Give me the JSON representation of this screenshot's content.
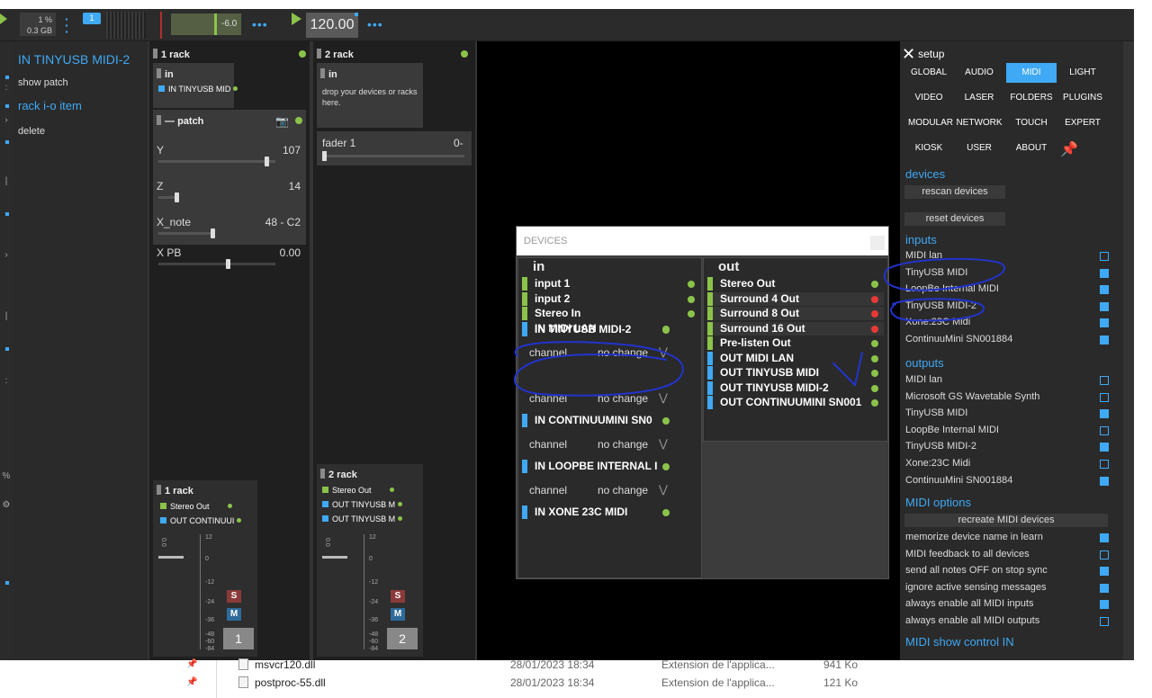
{
  "toolbar": {
    "cpu_percent": "1 %",
    "memory": "0.3 GB",
    "track_badge": "1",
    "volume_db": "-6.0",
    "more_icon": "ellipsis-icon",
    "tempo": "120.00"
  },
  "context_menu": {
    "title": "IN TINYUSB MIDI-2",
    "items": [
      "show patch",
      "rack i-o item",
      "delete"
    ]
  },
  "rack1": {
    "title": "1 rack",
    "in_label": "in",
    "in_device": "IN TINYUSB MID",
    "patch_label": "patch",
    "params": [
      {
        "name": "Y",
        "value": "107",
        "level": 0.94
      },
      {
        "name": "Z",
        "value": "14",
        "level": 0.15
      },
      {
        "name": "X_note",
        "value": "48 - C2",
        "level": 0.47
      },
      {
        "name": "X PB",
        "value": "0.00",
        "level": 0.6
      }
    ],
    "out_title": "1 rack",
    "out_rows": [
      "Stereo Out",
      "OUT CONTINUUI"
    ],
    "mixer_button": "1"
  },
  "rack2": {
    "title": "2 rack",
    "in_label": "in",
    "drop_hint": "drop your devices or racks here.",
    "fader_label": "fader 1",
    "fader_value": "0-",
    "out_title": "2 rack",
    "out_rows": [
      "Stereo Out",
      "OUT TINYUSB M",
      "OUT TINYUSB M"
    ],
    "mixer_button": "2"
  },
  "mixer_scale": [
    "12",
    "0",
    "-12",
    "-24",
    "-36",
    "-48",
    "-60",
    "-84"
  ],
  "mixer_meter": "0.0",
  "mixer_solo": "S",
  "mixer_mute": "M",
  "devices_dialog": {
    "title": "DEVICES",
    "in_header": "in",
    "out_header": "out",
    "inputs": [
      "input 1",
      "input 2",
      "Stereo In",
      "IN MIDI LAN"
    ],
    "midi_inputs": [
      "IN TINYUSB MIDI-2",
      "IN CONTINUUMINI SN0",
      "IN LOOPBE INTERNAL I",
      "IN XONE 23C MIDI"
    ],
    "channel_label": "channel",
    "channel_value": "no change",
    "outputs": [
      {
        "name": "Stereo Out",
        "status": "ok"
      },
      {
        "name": "Surround 4 Out",
        "status": "off"
      },
      {
        "name": "Surround 8 Out",
        "status": "off"
      },
      {
        "name": "Surround 16 Out",
        "status": "off"
      },
      {
        "name": "Pre-listen Out",
        "status": "ok"
      },
      {
        "name": "OUT MIDI LAN",
        "status": "ok"
      },
      {
        "name": "OUT TINYUSB MIDI",
        "status": "ok"
      },
      {
        "name": "OUT TINYUSB MIDI-2",
        "status": "ok"
      },
      {
        "name": "OUT CONTINUUMINI SN001",
        "status": "ok"
      }
    ]
  },
  "setup": {
    "title": "setup",
    "tabs": [
      "GLOBAL",
      "AUDIO",
      "MIDI",
      "LIGHT",
      "VIDEO",
      "LASER",
      "FOLDERS",
      "PLUGINS",
      "MODULAR",
      "NETWORK",
      "TOUCH",
      "EXPERT",
      "KIOSK",
      "USER",
      "ABOUT"
    ],
    "active_tab": "MIDI",
    "devices_label": "devices",
    "rescan": "rescan devices",
    "reset": "reset devices",
    "inputs_label": "inputs",
    "inputs": [
      {
        "name": "MIDI lan",
        "on": false
      },
      {
        "name": "TinyUSB MIDI",
        "on": true
      },
      {
        "name": "LoopBe Internal MIDI",
        "on": true
      },
      {
        "name": "TinyUSB MIDI-2",
        "on": true
      },
      {
        "name": "Xone:23C Midi",
        "on": true
      },
      {
        "name": "ContinuuMini SN001884",
        "on": true
      }
    ],
    "outputs_label": "outputs",
    "outputs": [
      {
        "name": "MIDI lan",
        "on": false
      },
      {
        "name": "Microsoft GS Wavetable Synth",
        "on": false
      },
      {
        "name": "TinyUSB MIDI",
        "on": true
      },
      {
        "name": "LoopBe Internal MIDI",
        "on": false
      },
      {
        "name": "TinyUSB MIDI-2",
        "on": true
      },
      {
        "name": "Xone:23C Midi",
        "on": false
      },
      {
        "name": "ContinuuMini SN001884",
        "on": true
      }
    ],
    "midi_options_label": "MIDI options",
    "recreate": "recreate MIDI devices",
    "options": [
      {
        "name": "memorize device name in learn",
        "on": true
      },
      {
        "name": "MIDI feedback to all devices",
        "on": false
      },
      {
        "name": "send all notes OFF on stop sync",
        "on": true
      },
      {
        "name": "ignore active sensing messages",
        "on": true
      },
      {
        "name": "always enable all MIDI inputs",
        "on": true
      },
      {
        "name": "always enable all MIDI outputs",
        "on": false
      }
    ],
    "show_control_label": "MIDI show control IN"
  },
  "explorer": {
    "files": [
      {
        "name": "msvcr120.dll",
        "date": "28/01/2023 18:34",
        "type": "Extension de l'applica...",
        "size": "941 Ko"
      },
      {
        "name": "postproc-55.dll",
        "date": "28/01/2023 18:34",
        "type": "Extension de l'applica...",
        "size": "121 Ko"
      }
    ]
  },
  "colors": {
    "accent": "#3fa9f5",
    "ok": "#8bc34a",
    "error": "#e53935"
  }
}
